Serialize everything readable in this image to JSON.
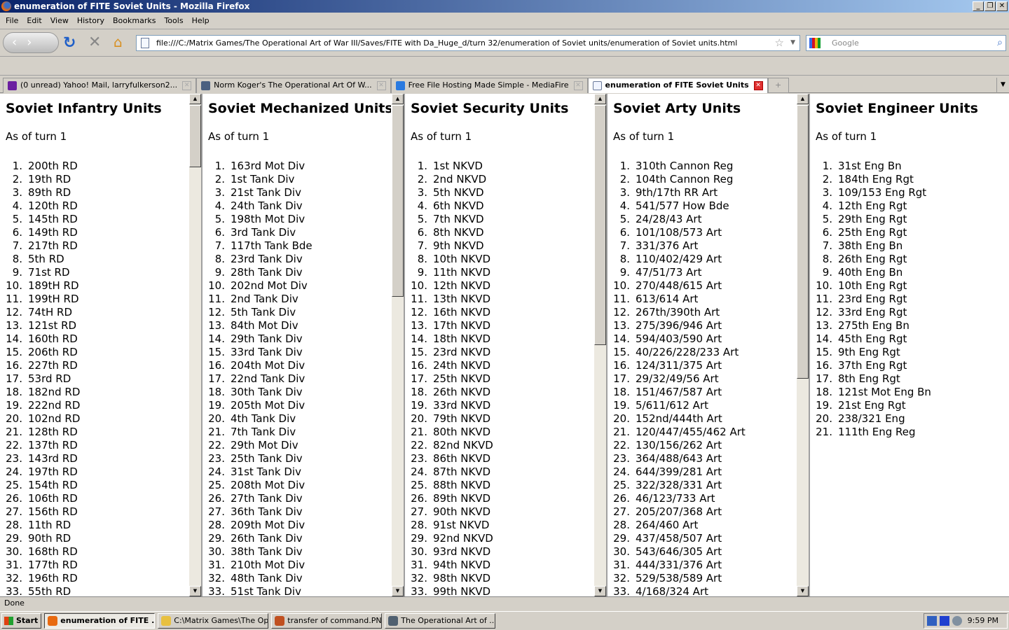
{
  "window": {
    "title": "enumeration of FITE Soviet Units - Mozilla Firefox"
  },
  "menu": [
    "File",
    "Edit",
    "View",
    "History",
    "Bookmarks",
    "Tools",
    "Help"
  ],
  "url": "file:///C:/Matrix Games/The Operational Art of War III/Saves/FITE with Da_Huge_d/turn 32/enumeration of Soviet units/enumeration of Soviet units.html",
  "search_placeholder": "Google",
  "tabs": [
    {
      "label": "(0 unread) Yahoo! Mail, larryfulkerson2...",
      "color": "#6b1fa0"
    },
    {
      "label": "Norm Koger's The Operational Art Of W...",
      "color": "#4a6080"
    },
    {
      "label": "Free File Hosting Made Simple - MediaFire",
      "color": "#2a7ae0"
    },
    {
      "label": "enumeration of FITE Soviet Units",
      "color": "#f0f4ff"
    }
  ],
  "status": "Done",
  "frames": [
    {
      "title": "Soviet Infantry Units",
      "subtitle": "As of turn 1",
      "items": [
        "200th RD",
        "19th RD",
        "89th RD",
        "120th RD",
        "145th RD",
        "149th RD",
        "217th RD",
        "5th RD",
        "71st RD",
        "189tH RD",
        "199tH RD",
        "74tH RD",
        "121st RD",
        "160th RD",
        "206th RD",
        "227th RD",
        "53rd RD",
        "182nd RD",
        "222nd RD",
        "102nd RD",
        "128th RD",
        "137th RD",
        "143rd RD",
        "197th RD",
        "154th RD",
        "106th RD",
        "156th RD",
        "11th RD",
        "90th RD",
        "168th RD",
        "177th RD",
        "196th RD",
        "55th RD"
      ]
    },
    {
      "title": "Soviet Mechanized Units",
      "subtitle": "As of turn 1",
      "items": [
        "163rd Mot Div",
        "1st Tank Div",
        "21st Tank Div",
        "24th Tank Div",
        "198th Mot Div",
        "3rd Tank Div",
        "117th Tank Bde",
        "23rd Tank Div",
        "28th Tank Div",
        "202nd Mot Div",
        "2nd Tank Div",
        "5th Tank Div",
        "84th Mot Div",
        "29th Tank Div",
        "33rd Tank Div",
        "204th Mot Div",
        "22nd Tank Div",
        "30th Tank Div",
        "205th Mot Div",
        "4th Tank Div",
        "7th Tank Div",
        "29th Mot Div",
        "25th Tank Div",
        "31st Tank Div",
        "208th Mot Div",
        "27th Tank Div",
        "36th Tank Div",
        "209th Mot Div",
        "26th Tank Div",
        "38th Tank Div",
        "210th Mot Div",
        "48th Tank Div",
        "51st Tank Div"
      ]
    },
    {
      "title": "Soviet Security Units",
      "subtitle": "As of turn 1",
      "items": [
        "1st NKVD",
        "2nd NKVD",
        "5th NKVD",
        "6th NKVD",
        "7th NKVD",
        "8th NKVD",
        "9th NKVD",
        "10th NKVD",
        "11th NKVD",
        "12th NKVD",
        "13th NKVD",
        "16th NKVD",
        "17th NKVD",
        "18th NKVD",
        "23rd NKVD",
        "24th NKVD",
        "25th NKVD",
        "26th NKVD",
        "33rd NKVD",
        "79th NKVD",
        "80th NKVD",
        "82nd NKVD",
        "86th NKVD",
        "87th NKVD",
        "88th NKVD",
        "89th NKVD",
        "90th NKVD",
        "91st NKVD",
        "92nd NKVD",
        "93rd NKVD",
        "94th NKVD",
        "98th NKVD",
        "99th NKVD"
      ]
    },
    {
      "title": "Soviet Arty Units",
      "subtitle": "As of turn 1",
      "items": [
        "310th Cannon Reg",
        "104th Cannon Reg",
        "9th/17th RR Art",
        "541/577 How Bde",
        "24/28/43 Art",
        "101/108/573 Art",
        "331/376 Art",
        "110/402/429 Art",
        "47/51/73 Art",
        "270/448/615 Art",
        "613/614 Art",
        "267th/390th Art",
        "275/396/946 Art",
        "594/403/590 Art",
        "40/226/228/233 Art",
        "124/311/375 Art",
        "29/32/49/56 Art",
        "151/467/587 Art",
        "5/611/612 Art",
        "152nd/444th Art",
        "120/447/455/462 Art",
        "130/156/262 Art",
        "364/488/643 Art",
        "644/399/281 Art",
        "322/328/331 Art",
        "46/123/733 Art",
        "205/207/368 Art",
        "264/460 Art",
        "437/458/507 Art",
        "543/646/305 Art",
        "444/331/376 Art",
        "529/538/589 Art",
        "4/168/324 Art"
      ]
    },
    {
      "title": "Soviet Engineer Units",
      "subtitle": "As of turn 1",
      "items": [
        "31st Eng Bn",
        "184th Eng Rgt",
        "109/153 Eng Rgt",
        "12th Eng Rgt",
        "29th Eng Rgt",
        "25th Eng Rgt",
        "38th Eng Bn",
        "26th Eng Rgt",
        "40th Eng Bn",
        "10th Eng Rgt",
        "23rd Eng Rgt",
        "33rd Eng Rgt",
        "275th Eng Bn",
        "45th Eng Rgt",
        "9th Eng Rgt",
        "37th Eng Rgt",
        "8th Eng Rgt",
        "121st Mot Eng Bn",
        "21st Eng Rgt",
        "238/321 Eng",
        "111th Eng Reg"
      ]
    }
  ],
  "scroll_fractions": [
    0.13,
    0.4,
    0.5,
    0.57,
    null
  ],
  "taskbar": {
    "start": "Start",
    "tasks": [
      {
        "label": "enumeration of FITE ...",
        "color": "#e86a10",
        "active": true
      },
      {
        "label": "C:\\Matrix Games\\The Op...",
        "color": "#e8c040"
      },
      {
        "label": "transfer of command.PN...",
        "color": "#c05020"
      },
      {
        "label": "The Operational Art of ...",
        "color": "#506070"
      }
    ],
    "clock": "9:59 PM"
  }
}
